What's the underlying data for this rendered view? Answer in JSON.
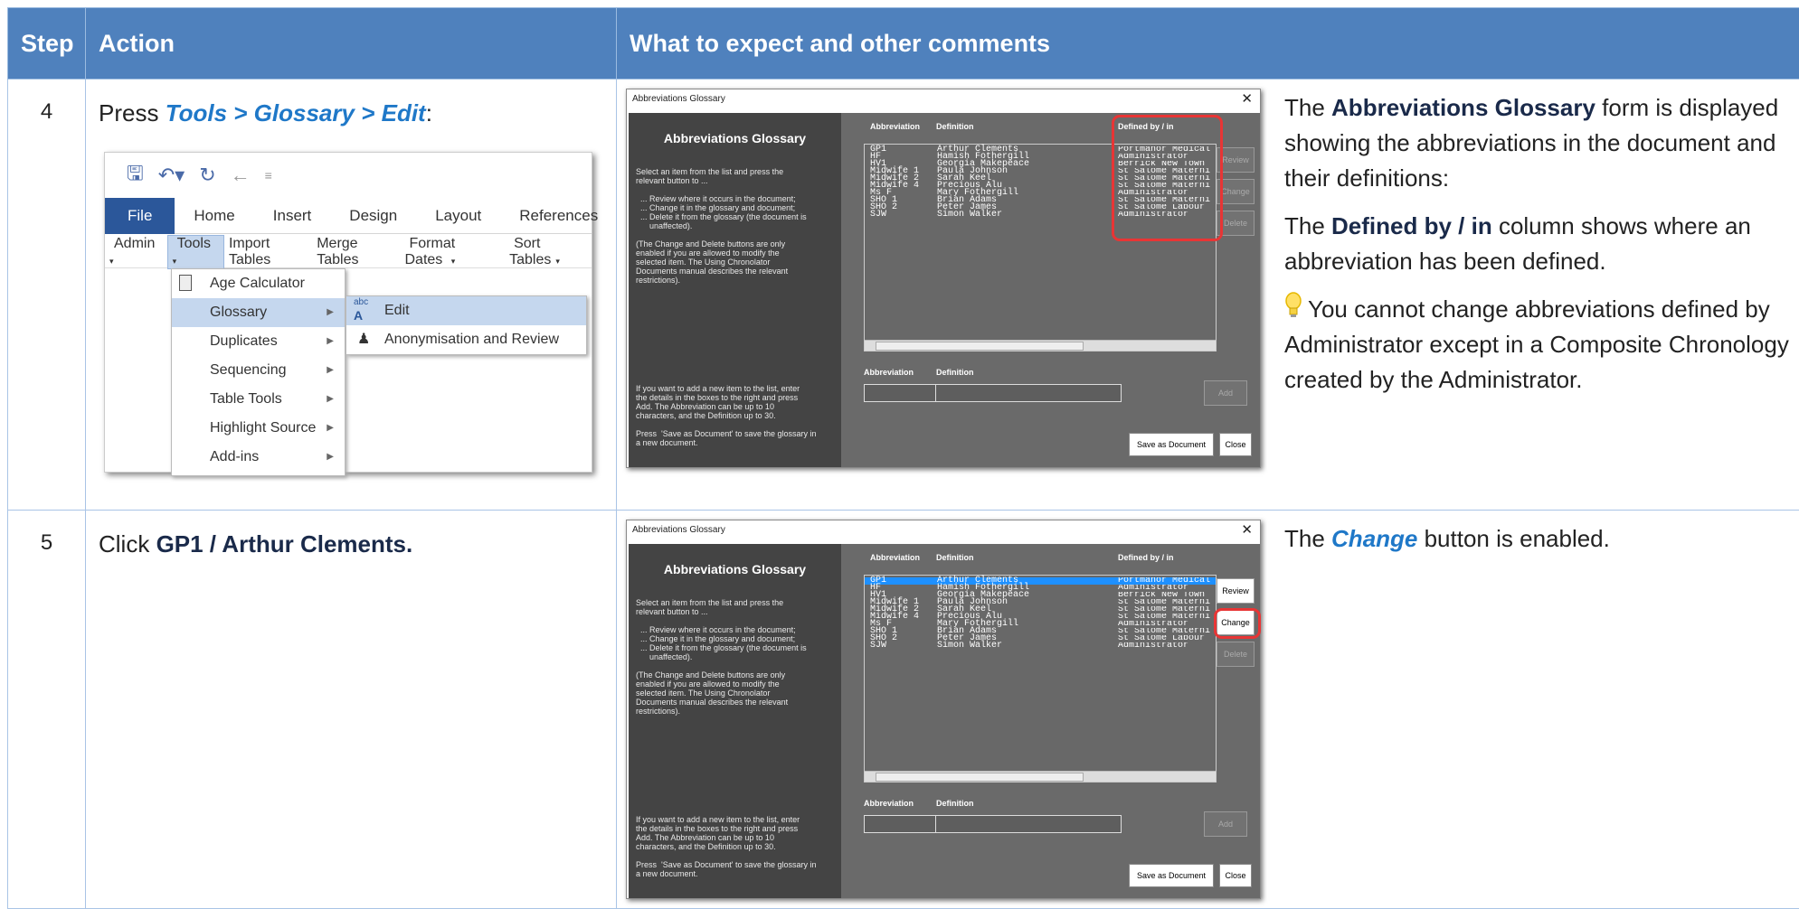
{
  "headers": {
    "step": "Step",
    "action": "Action",
    "expect": "What to expect and other comments"
  },
  "row4": {
    "step": "4",
    "action_prefix": "Press ",
    "action_kw": "Tools > Glossary > Edit",
    "action_suffix": ":",
    "ribbon": {
      "tabs": [
        "File",
        "Home",
        "Insert",
        "Design",
        "Layout",
        "References"
      ],
      "toolbar": [
        "Admin",
        "Tools",
        "Import Tables",
        "Merge Tables",
        "Format Dates",
        "Sort Tables"
      ],
      "menu": [
        "Age Calculator",
        "Glossary",
        "Duplicates",
        "Sequencing",
        "Table Tools",
        "Highlight Source",
        "Add-ins"
      ],
      "submenu": [
        "Edit",
        "Anonymisation and Review"
      ]
    },
    "c1_a": "The ",
    "c1_b": "Abbreviations Glossary",
    "c1_c": " form is displayed showing the abbreviations in the document and their definitions:",
    "c2_a": "The ",
    "c2_b": "Defined by / in",
    "c2_c": " column shows where an abbreviation has been defined.",
    "c3": "You cannot change abbreviations defined by Administrator except in a Composite Chronology created by the Administrator."
  },
  "row5": {
    "step": "5",
    "action_prefix": "Click ",
    "action_bold": "GP1 / Arthur Clements.",
    "c1_a": "The ",
    "c1_b": "Change",
    "c1_c": "  button is enabled."
  },
  "dialog": {
    "title": "Abbreviations Glossary",
    "heading": "Abbreviations Glossary",
    "left_text1": "Select an item from the list and press the\nrelevant button to ...\n\n  ... Review where it occurs in the document;\n  ... Change it in the glossary and document;\n  ... Delete it from the glossary (the document is\n      unaffected).\n\n(The Change and Delete buttons are only\nenabled if you are allowed to modify the\nselected item. The Using Chronolator\nDocuments manual describes the relevant\nrestrictions).",
    "left_text2": "If you want to add a new item to the list, enter\nthe details in the boxes to the right and press\nAdd. The Abbreviation can be up to 10\ncharacters, and the Definition up to 30.\n\nPress  'Save as Document' to save the glossary in\na new document.",
    "col_abbr": "Abbreviation",
    "col_def": "Definition",
    "col_by": "Defined by / in",
    "rows": [
      [
        "GP1",
        "Arthur Clements",
        "Portmanor Medical"
      ],
      [
        "HF",
        "Hamish Fothergill",
        "Administrator"
      ],
      [
        "HV1",
        "Georgia Makepeace",
        "Berrick New Town"
      ],
      [
        "Midwife 1",
        "Paula Johnson",
        "St Salome Materni"
      ],
      [
        "Midwife 2",
        "Sarah Keel",
        "St Salome Materni"
      ],
      [
        "Midwife 4",
        "Precious Alu",
        "St Salome Materni"
      ],
      [
        "Ms F",
        "Mary Fothergill",
        "Administrator"
      ],
      [
        "SHO 1",
        "Brian Adams",
        "St Salome Materni"
      ],
      [
        "SHO 2",
        "Peter James",
        "St Salome Labour"
      ],
      [
        "SJW",
        "Simon Walker",
        "Administrator"
      ]
    ],
    "btn_review": "Review",
    "btn_change": "Change",
    "btn_delete": "Delete",
    "lbl_abbr": "Abbreviation",
    "lbl_def": "Definition",
    "btn_add": "Add",
    "btn_save": "Save as Document",
    "btn_close": "Close"
  }
}
